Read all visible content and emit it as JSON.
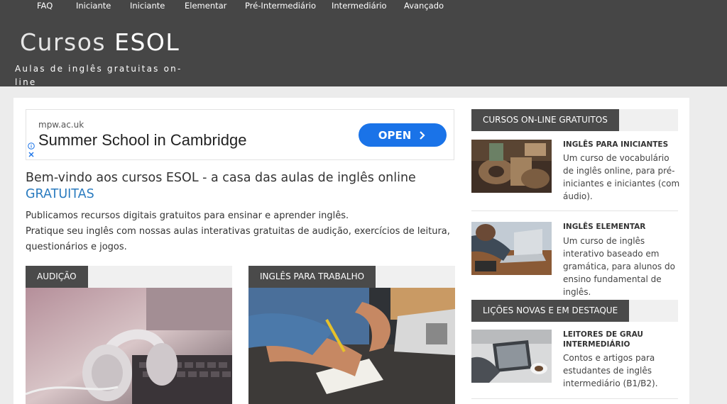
{
  "nav": [
    "FAQ",
    "Iniciante",
    "Iniciante",
    "Elementar",
    "Pré-Intermediário",
    "Intermediário",
    "Avançado"
  ],
  "site": {
    "title_light": "Cursos",
    "title_bold": "ESOL",
    "tagline": "Aulas de inglês gratuitas on-line"
  },
  "ad": {
    "domain": "mpw.ac.uk",
    "title": "Summer School in Cambridge",
    "button": "OPEN",
    "info_icon": "info-icon",
    "close_icon": "close-icon",
    "button_color": "#1a73e8"
  },
  "welcome": {
    "title_main": "Bem-vindo aos cursos ESOL - a casa das aulas de inglês online ",
    "title_accent": "GRATUITAS",
    "para_line1": "Publicamos recursos digitais gratuitos para ensinar e aprender inglês.",
    "para_line2": "Pratique seu inglês com nossas aulas interativas gratuitas de audição, exercícios de leitura, questionários e jogos."
  },
  "cards": [
    {
      "label": "AUDIÇÃO"
    },
    {
      "label": "INGLÊS PARA TRABALHO"
    }
  ],
  "sidebar": {
    "section1": "CURSOS ON-LINE GRATUITOS",
    "section2": "LIÇÕES NOVAS E EM DESTAQUE",
    "items": [
      {
        "title": "INGLÊS PARA INICIANTES",
        "desc": "Um curso de vocabulário de inglês online, para pré-iniciantes e iniciantes (com áudio)."
      },
      {
        "title": "INGLÊS ELEMENTAR",
        "desc": "Um curso de inglês interativo baseado em gramática, para alunos do ensino fundamental de inglês."
      },
      {
        "title": "LEITORES DE GRAU INTERMEDIÁRIO",
        "desc": "Contos e artigos para estudantes de inglês intermediário (B1/B2)."
      }
    ]
  },
  "colors": {
    "header_bg": "#464646",
    "label_bg": "#4a4a4a",
    "accent": "#2a7bbf"
  }
}
